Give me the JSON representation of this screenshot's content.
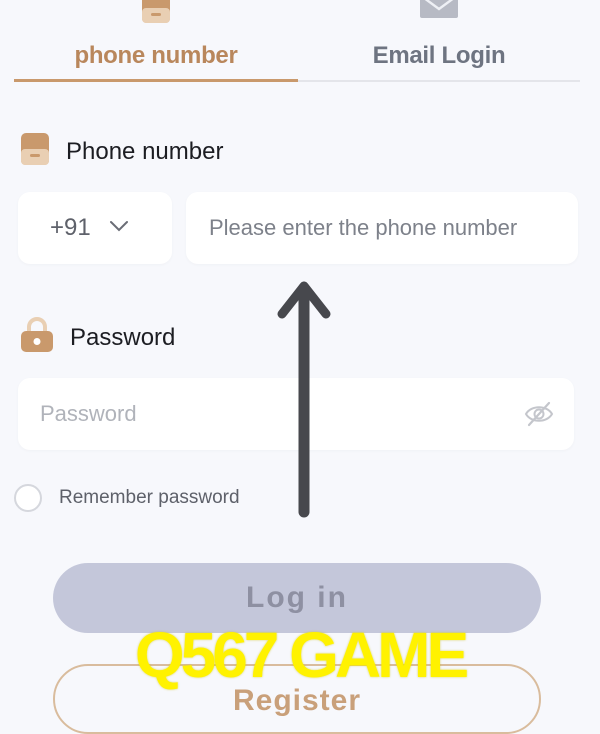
{
  "tabs": {
    "phone_label": "phone number",
    "email_label": "Email Login",
    "active": "phone number"
  },
  "phone_section": {
    "label": "Phone number",
    "country_code": "+91",
    "placeholder": "Please enter the phone number",
    "icon": "phone-icon"
  },
  "password_section": {
    "label": "Password",
    "placeholder": "Password",
    "icon": "lock-icon",
    "toggle_icon": "eye-off-icon"
  },
  "remember": {
    "label": "Remember password",
    "checked": false
  },
  "buttons": {
    "login_label": "Log in",
    "register_label": "Register"
  },
  "overlay": {
    "watermark": "Q567 GAME",
    "arrow_icon": "arrow-up-icon"
  },
  "colors": {
    "accent": "#c9996c",
    "login_button": "#c4c7da",
    "background": "#f7f8fc",
    "watermark": "#fff200"
  }
}
